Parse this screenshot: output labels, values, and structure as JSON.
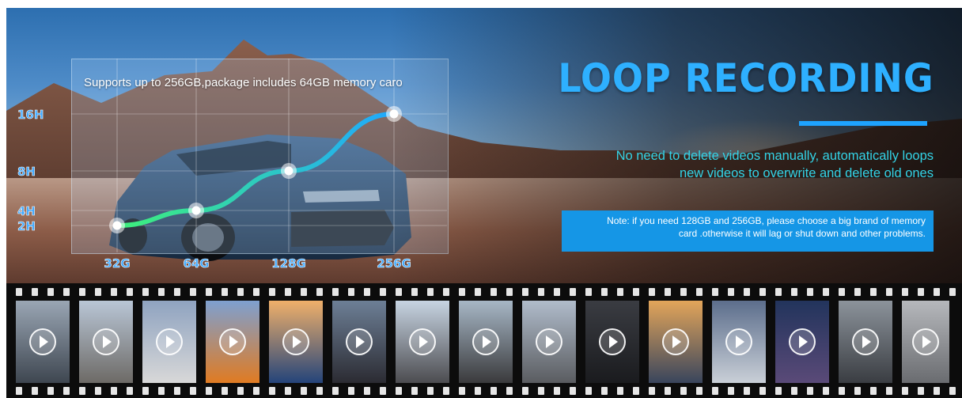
{
  "headline": "LOOP RECORDING",
  "subtitle_lines": [
    "No need to delete videos manually, automatically loops",
    "new videos to overwrite and delete old ones"
  ],
  "note_lines": [
    "Note: if you need 128GB and 256GB, please choose a big brand of memory",
    "card .otherwise it will lag or shut down and other problems."
  ],
  "chart_data": {
    "type": "line",
    "title": "Supports up to 256GB,package includes 64GB memory caro",
    "categories": [
      "32G",
      "64G",
      "128G",
      "256G"
    ],
    "y_ticks": [
      "16H",
      "8H",
      "4H",
      "2H"
    ],
    "values": [
      "2H",
      "4H",
      "8H",
      "16H"
    ],
    "xlabel": "",
    "ylabel": "",
    "grid": true
  },
  "colors": {
    "accent": "#1ea3ff",
    "subtitle": "#33d3e6",
    "tick_label": "#3ea9ff",
    "line_start": "#3ef07a",
    "line_end": "#1fa8ff",
    "note_bg": "#1596e6"
  },
  "film_icons": "play-icon"
}
